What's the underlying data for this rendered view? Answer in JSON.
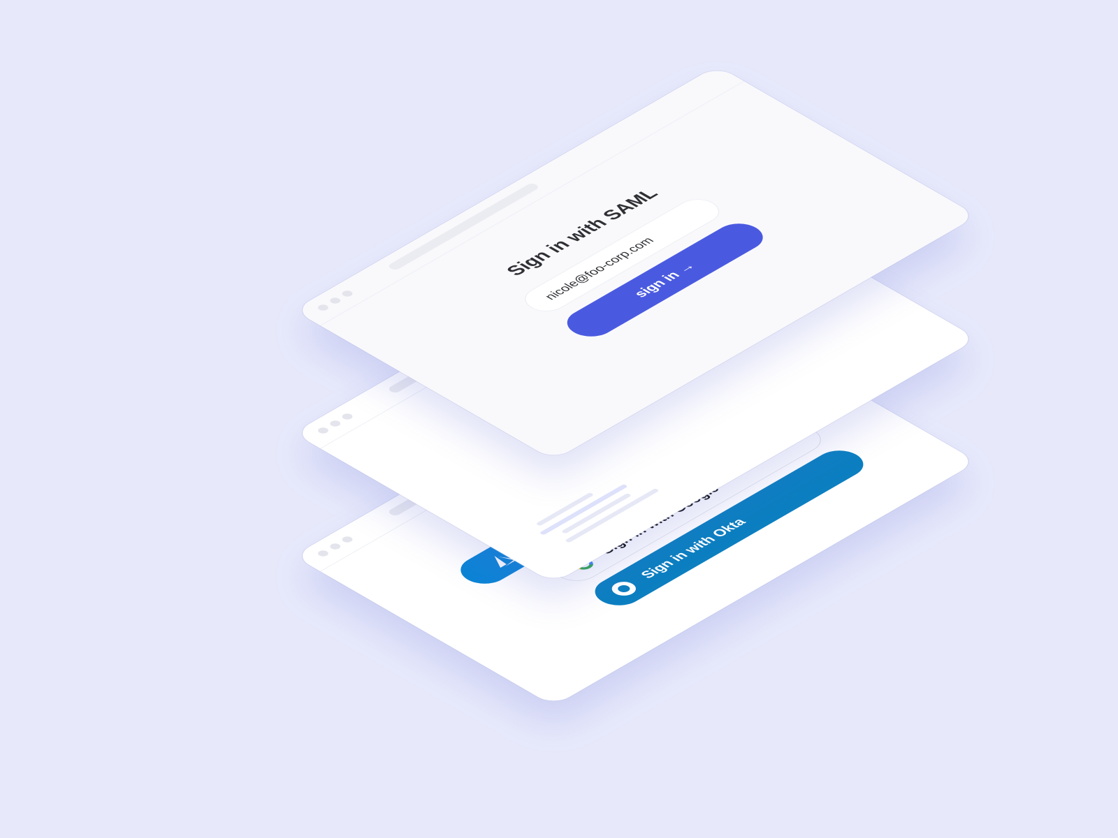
{
  "saml_window": {
    "title": "Sign in with SAML",
    "email_value": "nicole@foo-corp.com",
    "button_label": "sign in",
    "button_arrow": "→",
    "accent_color": "#4a5ae0"
  },
  "middle_window": {
    "logo_icon": "cube-logo-icon"
  },
  "sso_window": {
    "azure_icon": "azure-icon",
    "google_label": "Sign in with Google",
    "google_icon": "google-g-icon",
    "okta_label": "Sign in with Okta",
    "okta_icon": "okta-ring-icon",
    "azure_color": "#0b84d6",
    "okta_color": "#0c7fc1"
  },
  "background_color": "#e7e9fb"
}
